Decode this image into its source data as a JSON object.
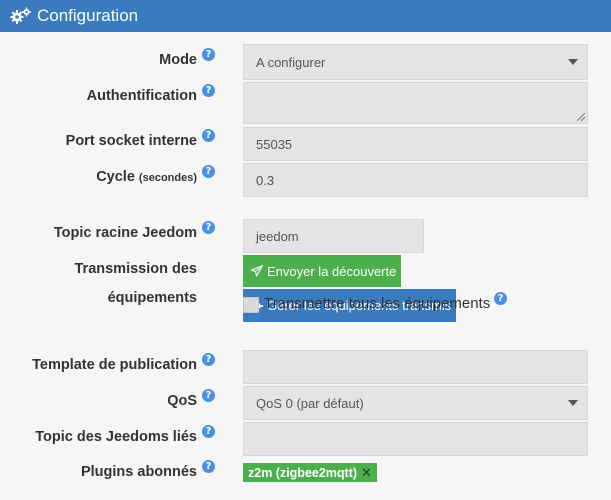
{
  "header": {
    "title": "Configuration"
  },
  "mode": {
    "label": "Mode",
    "value": "A configurer"
  },
  "auth": {
    "label": "Authentification",
    "value": ""
  },
  "port": {
    "label": "Port socket interne",
    "value": "55035"
  },
  "cycle": {
    "label": "Cycle",
    "unit": "(secondes)",
    "value": "0.3"
  },
  "topic_root": {
    "label": "Topic racine Jeedom",
    "value": "jeedom"
  },
  "transmission": {
    "label_line1": "Transmission des",
    "label_line2": "équipements",
    "send_discovery_label": "Envoyer la découverte",
    "manage_label": "Gérer les équipements transmis",
    "transmit_all_label": "Transmettre tous les équipements",
    "transmit_all_checked": false
  },
  "template": {
    "label": "Template de publication",
    "value": ""
  },
  "qos": {
    "label": "QoS",
    "value": "QoS 0 (par défaut)"
  },
  "linked_topics": {
    "label": "Topic des Jeedoms liés",
    "value": ""
  },
  "plugins": {
    "label": "Plugins abonnés",
    "tags": [
      "z2m (zigbee2mqtt)"
    ]
  },
  "help_glyph": "?",
  "remove_glyph": "✕",
  "colors": {
    "header": "#3a7bbf",
    "green": "#4cae4c",
    "blue": "#3a7bbf",
    "help": "#4a90e2",
    "field": "#e4e4e4"
  }
}
